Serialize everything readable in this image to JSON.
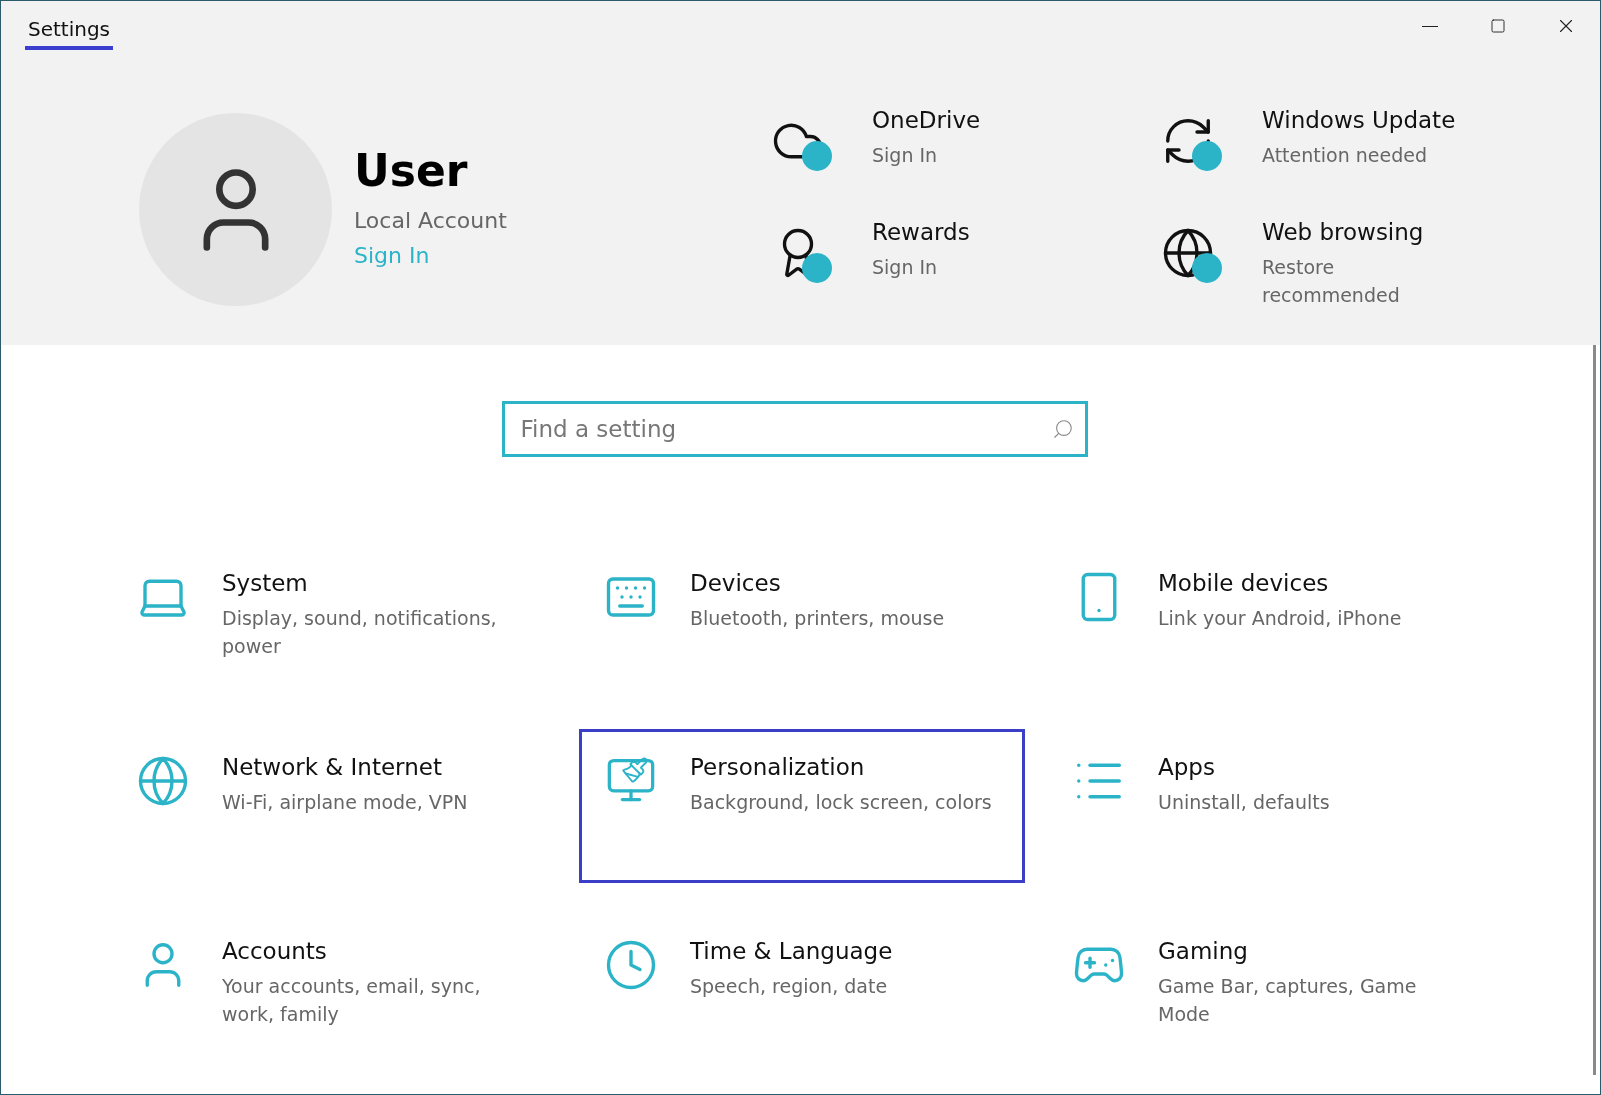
{
  "window": {
    "title": "Settings"
  },
  "account": {
    "name": "User",
    "type": "Local Account",
    "link": "Sign In"
  },
  "services": [
    {
      "kind": "cloud",
      "title": "OneDrive",
      "status": "Sign In"
    },
    {
      "kind": "update",
      "title": "Windows Update",
      "status": "Attention needed"
    },
    {
      "kind": "rewards",
      "title": "Rewards",
      "status": "Sign In"
    },
    {
      "kind": "web",
      "title": "Web browsing",
      "status": "Restore recommended"
    }
  ],
  "search": {
    "placeholder": "Find a setting"
  },
  "categories": [
    {
      "kind": "system",
      "title": "System",
      "description": "Display, sound, notifications, power",
      "selected": false
    },
    {
      "kind": "devices",
      "title": "Devices",
      "description": "Bluetooth, printers, mouse",
      "selected": false
    },
    {
      "kind": "mobile",
      "title": "Mobile devices",
      "description": "Link your Android, iPhone",
      "selected": false
    },
    {
      "kind": "network",
      "title": "Network & Internet",
      "description": "Wi-Fi, airplane mode, VPN",
      "selected": false
    },
    {
      "kind": "personalization",
      "title": "Personalization",
      "description": "Background, lock screen, colors",
      "selected": true
    },
    {
      "kind": "apps",
      "title": "Apps",
      "description": "Uninstall, defaults",
      "selected": false
    },
    {
      "kind": "accounts",
      "title": "Accounts",
      "description": "Your accounts, email, sync, work, family",
      "selected": false
    },
    {
      "kind": "time",
      "title": "Time & Language",
      "description": "Speech, region, date",
      "selected": false
    },
    {
      "kind": "gaming",
      "title": "Gaming",
      "description": "Game Bar, captures, Game Mode",
      "selected": false
    }
  ]
}
